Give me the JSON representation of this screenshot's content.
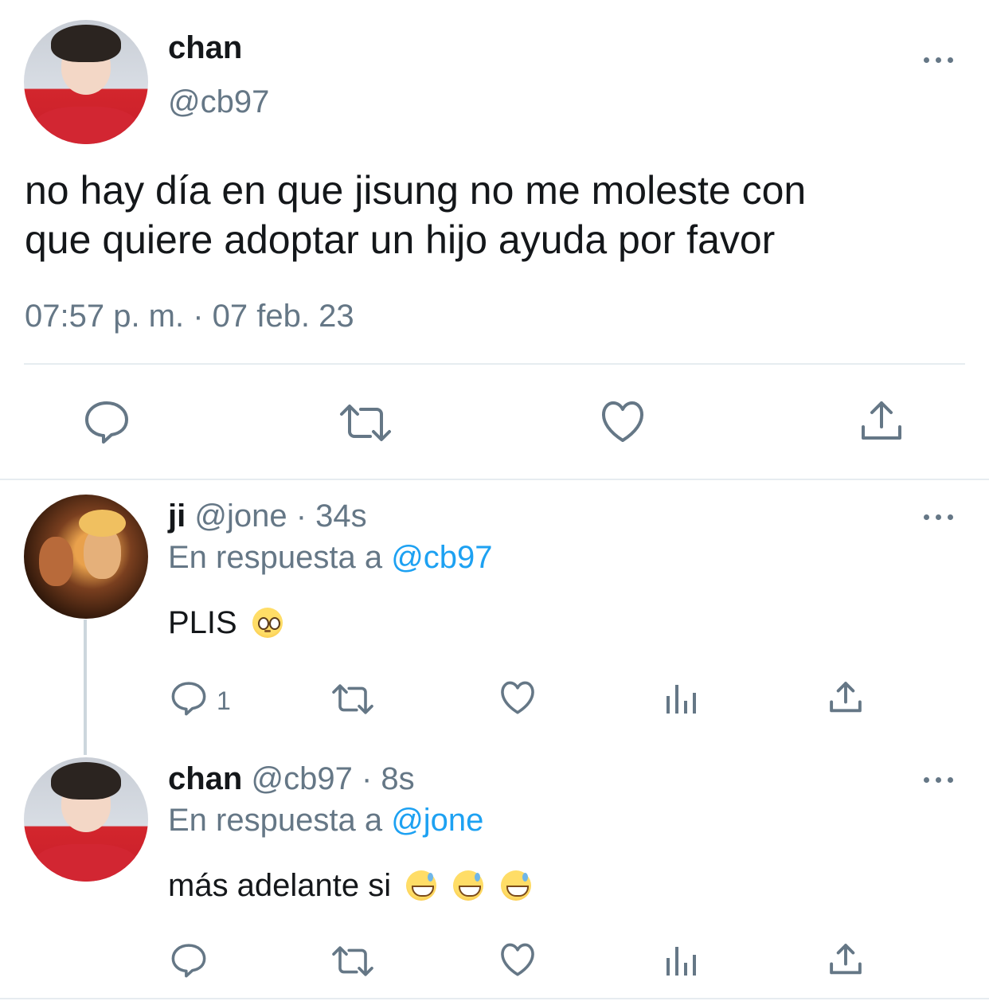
{
  "main_tweet": {
    "display_name": "chan",
    "handle": "@cb97",
    "text_line1": "no hay día en que jisung no me moleste con",
    "text_line2": "que quiere adoptar un hijo ayuda por favor",
    "timestamp": "07:57 p. m. · 07 feb. 23"
  },
  "reply1": {
    "display_name": "ji",
    "handle": "@jone",
    "time": "· 34s",
    "reply_prefix": "En respuesta a",
    "reply_to": "@cb97",
    "text": "PLIS",
    "reply_count": "1"
  },
  "reply2": {
    "display_name": "chan",
    "handle": "@cb97",
    "time": "· 8s",
    "reply_prefix": "En respuesta a",
    "reply_to": "@jone",
    "text": "más adelante si"
  },
  "icons": {
    "reply": "reply-icon",
    "retweet": "retweet-icon",
    "like": "heart-icon",
    "share": "share-icon",
    "analytics": "analytics-icon",
    "more": "more-icon"
  },
  "colors": {
    "link": "#1da1f2",
    "muted": "#657786",
    "text": "#14171a",
    "divider": "#e6ecf0"
  }
}
